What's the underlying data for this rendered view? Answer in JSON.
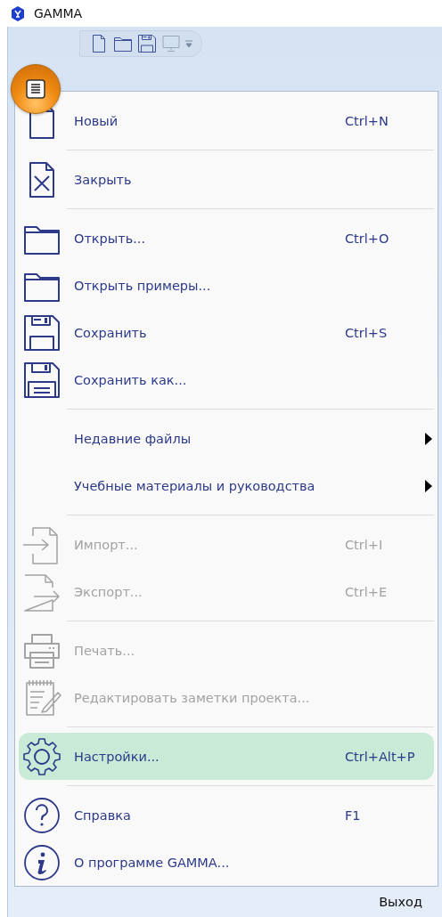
{
  "window": {
    "title": "GAMMA"
  },
  "quick_access": [
    {
      "kind": "new",
      "disabled": false
    },
    {
      "kind": "open",
      "disabled": false
    },
    {
      "kind": "save",
      "disabled": false
    },
    {
      "kind": "screen",
      "disabled": true
    }
  ],
  "menu": {
    "groups": [
      {
        "items": [
          {
            "kind": "new",
            "label": "Новый",
            "shortcut": "Ctrl+N",
            "disabled": false,
            "highlighted": false,
            "submenu": false
          }
        ]
      },
      {
        "items": [
          {
            "kind": "close",
            "label": "Закрыть",
            "disabled": false,
            "highlighted": false,
            "submenu": false
          }
        ]
      },
      {
        "items": [
          {
            "kind": "open",
            "label": "Открыть...",
            "shortcut": "Ctrl+O",
            "disabled": false,
            "highlighted": false,
            "submenu": false
          },
          {
            "kind": "open",
            "label": "Открыть примеры...",
            "disabled": false,
            "highlighted": false,
            "submenu": false
          },
          {
            "kind": "save",
            "label": "Сохранить",
            "shortcut": "Ctrl+S",
            "disabled": false,
            "highlighted": false,
            "submenu": false
          },
          {
            "kind": "save-as",
            "label": "Сохранить как...",
            "disabled": false,
            "highlighted": false,
            "submenu": false
          }
        ]
      },
      {
        "items": [
          {
            "kind": "none",
            "label": "Недавние файлы",
            "disabled": false,
            "highlighted": false,
            "submenu": true
          },
          {
            "kind": "none",
            "label": "Учебные материалы и руководства",
            "disabled": false,
            "highlighted": false,
            "submenu": true
          }
        ]
      },
      {
        "items": [
          {
            "kind": "import",
            "label": "Импорт...",
            "shortcut": "Ctrl+I",
            "disabled": true,
            "highlighted": false,
            "submenu": false
          },
          {
            "kind": "export",
            "label": "Экспорт...",
            "shortcut": "Ctrl+E",
            "disabled": true,
            "highlighted": false,
            "submenu": false
          }
        ]
      },
      {
        "items": [
          {
            "kind": "print",
            "label": "Печать...",
            "disabled": true,
            "highlighted": false,
            "submenu": false
          },
          {
            "kind": "notes",
            "label": "Редактировать заметки проекта...",
            "disabled": true,
            "highlighted": false,
            "submenu": false
          }
        ]
      },
      {
        "items": [
          {
            "kind": "settings",
            "label": "Настройки...",
            "shortcut": "Ctrl+Alt+P",
            "disabled": false,
            "highlighted": true,
            "submenu": false
          }
        ]
      },
      {
        "items": [
          {
            "kind": "help",
            "label": "Справка",
            "shortcut": "F1",
            "disabled": false,
            "highlighted": false,
            "submenu": false
          },
          {
            "kind": "about",
            "label": "О программе GAMMA...",
            "disabled": false,
            "highlighted": false,
            "submenu": false
          }
        ]
      }
    ]
  },
  "footer": {
    "exit_button": "Выход"
  }
}
